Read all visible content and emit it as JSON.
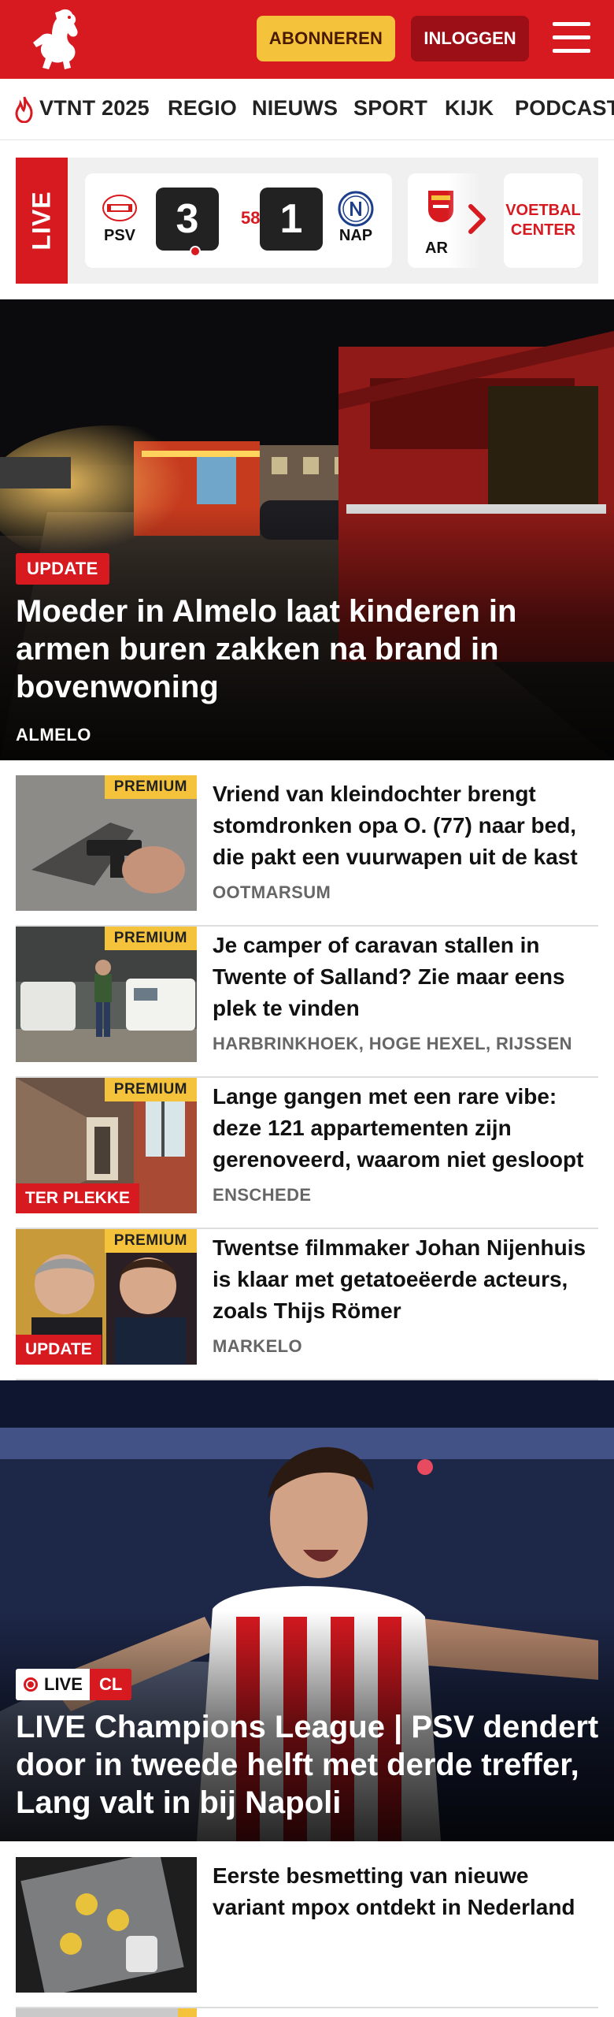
{
  "header": {
    "subscribe_label": "ABONNEREN",
    "login_label": "INLOGGEN",
    "brand_color": "#d71920"
  },
  "nav": {
    "items": [
      "VTNT 2025",
      "REGIO",
      "NIEUWS",
      "SPORT",
      "KIJK",
      "PODCAST"
    ]
  },
  "live_scores": {
    "label": "LIVE",
    "match": {
      "home_team": "PSV",
      "away_team": "NAP",
      "home_score": "3",
      "away_score": "1",
      "minute": "58'"
    },
    "next_match_team": "AR",
    "center_link": "VOETBAL CENTER"
  },
  "hero": {
    "badge": "UPDATE",
    "title": "Moeder in Almelo laat kinderen in armen buren zakken na brand in bovenwoning",
    "location": "ALMELO"
  },
  "articles": [
    {
      "premium_label": "PREMIUM",
      "title": "Vriend van kleindochter brengt stomdronken opa O. (77) naar bed, die pakt een vuurwapen uit de kast",
      "location": "OOTMARSUM",
      "badge": ""
    },
    {
      "premium_label": "PREMIUM",
      "title": "Je camper of caravan stallen in Twente of Salland? Zie maar eens plek te vinden",
      "location": "HARBRINKHOEK, HOGE HEXEL, RIJSSEN",
      "badge": ""
    },
    {
      "premium_label": "PREMIUM",
      "title": "Lange gangen met een rare vibe: deze 121 appartementen zijn gerenoveerd, waarom niet gesloopt",
      "location": "ENSCHEDE",
      "badge": "TER PLEKKE"
    },
    {
      "premium_label": "PREMIUM",
      "title": "Twentse filmmaker Johan Nijenhuis is klaar met getatoeëerde acteurs, zoals Thijs Römer",
      "location": "MARKELO",
      "badge": "UPDATE"
    }
  ],
  "hero2": {
    "live_label": "LIVE",
    "tag": "CL",
    "title": "LIVE Champions League | PSV dendert door in tweede helft met derde treffer, Lang valt in bij Napoli"
  },
  "article_last": {
    "title": "Eerste besmetting van nieuwe variant mpox ontdekt in Nederland"
  }
}
